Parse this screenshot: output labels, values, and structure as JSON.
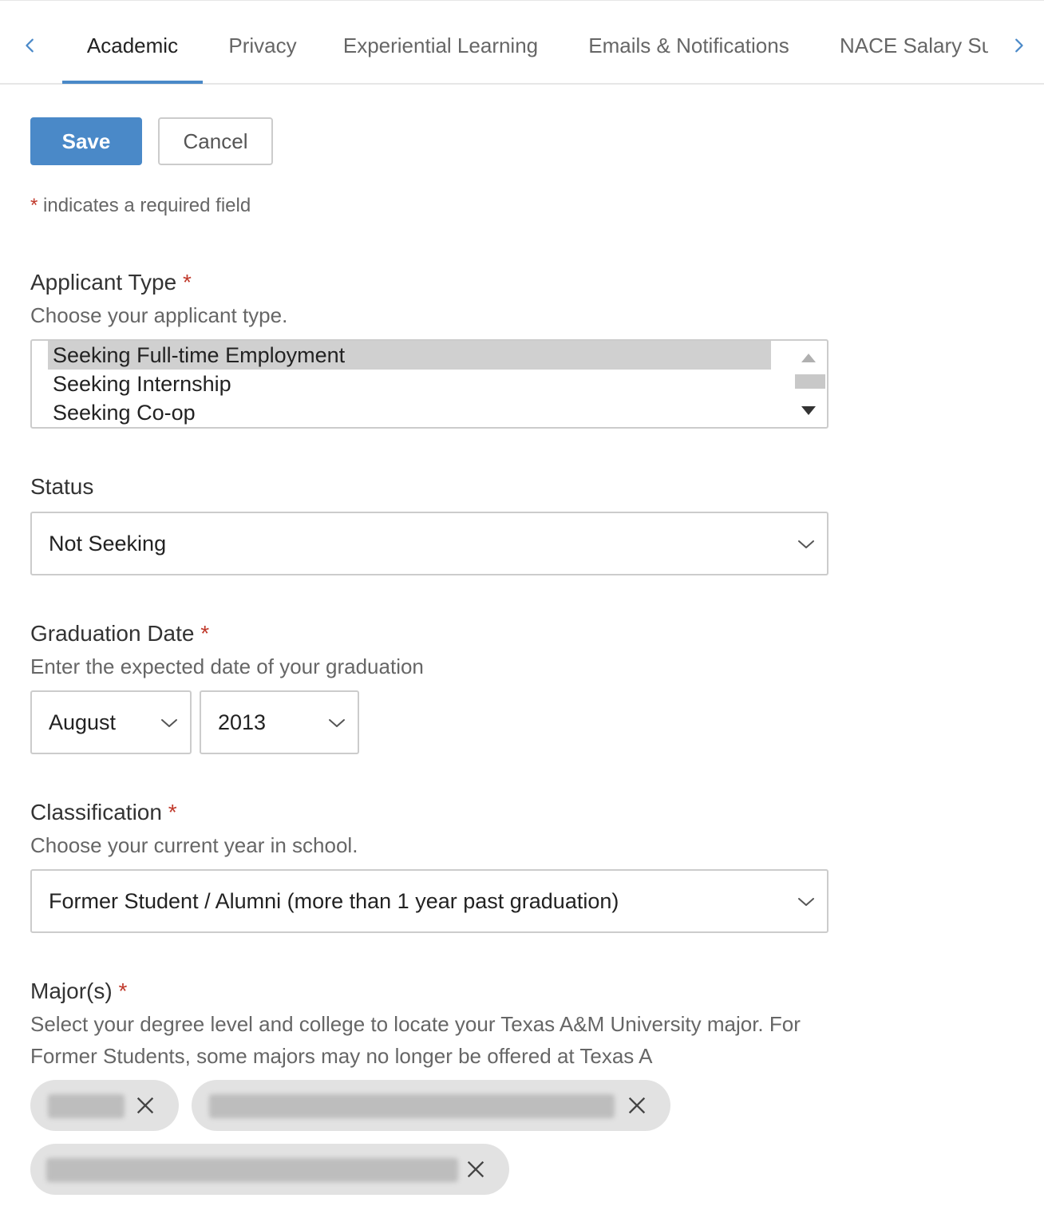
{
  "tabs": {
    "items": [
      {
        "label": "Academic"
      },
      {
        "label": "Privacy"
      },
      {
        "label": "Experiential Learning"
      },
      {
        "label": "Emails & Notifications"
      },
      {
        "label": "NACE Salary Survey"
      }
    ],
    "active": "Academic"
  },
  "actions": {
    "save_label": "Save",
    "cancel_label": "Cancel"
  },
  "required_note": {
    "star": "*",
    "text": "indicates a required field"
  },
  "applicant_type": {
    "label": "Applicant Type",
    "required_star": "*",
    "help": "Choose your applicant type.",
    "options": [
      "Seeking Full-time Employment",
      "Seeking Internship",
      "Seeking Co-op"
    ],
    "selected": "Seeking Full-time Employment"
  },
  "status": {
    "label": "Status",
    "value": "Not Seeking"
  },
  "graduation_date": {
    "label": "Graduation Date",
    "required_star": "*",
    "help": "Enter the expected date of your graduation",
    "month": "August",
    "year": "2013"
  },
  "classification": {
    "label": "Classification",
    "required_star": "*",
    "help": "Choose your current year in school.",
    "value": "Former Student / Alumni (more than 1 year past graduation)"
  },
  "majors": {
    "label": "Major(s)",
    "required_star": "*",
    "help_line1": "Select your degree level and college to locate your Texas A&M University major. For",
    "help_line2": "Former Students, some majors may no longer be offered at Texas A",
    "chips_count_visible": 3
  },
  "icons": {
    "tab_prev": "chevron-left-icon",
    "tab_next": "chevron-right-icon",
    "select_arrow": "chevron-down-icon",
    "chip_remove": "close-icon"
  },
  "colors": {
    "accent": "#4a89c8",
    "required": "#c0392b",
    "chip_bg": "#e2e2e2",
    "selected_option_bg": "#d0d0d0"
  }
}
